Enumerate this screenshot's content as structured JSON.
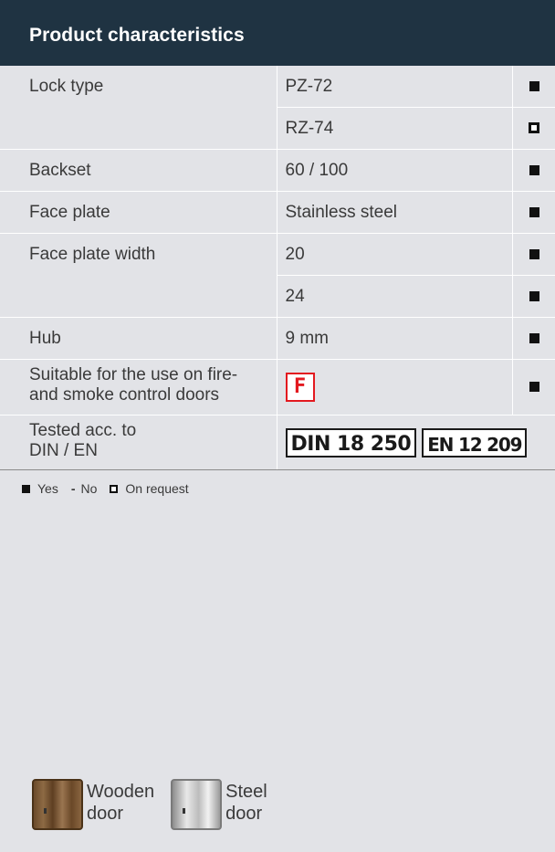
{
  "header": {
    "title": "Product characteristics"
  },
  "rows": [
    {
      "label": "Lock type",
      "value": "PZ-72",
      "marker": "filled"
    },
    {
      "label": "",
      "value": "RZ-74",
      "marker": "open"
    },
    {
      "label": "Backset",
      "value": "60 / 100",
      "marker": "filled"
    },
    {
      "label": "Face plate",
      "value": "Stainless steel",
      "marker": "filled"
    },
    {
      "label": "Face plate width",
      "value": "20",
      "marker": "filled"
    },
    {
      "label": "",
      "value": "24",
      "marker": "filled"
    },
    {
      "label": "Hub",
      "value": "9 mm",
      "marker": "filled"
    },
    {
      "label_line1": "Suitable for the use on fire-",
      "label_line2": "and smoke control doors",
      "badge": "F",
      "marker": "filled"
    },
    {
      "label_line1": "Tested acc. to",
      "label_line2": "DIN / EN",
      "standards": [
        "DIN 18 250",
        "EN 12 209"
      ]
    }
  ],
  "legend": {
    "yes": "Yes",
    "no_symbol": "-",
    "no": "No",
    "on_request": "On request"
  },
  "doors": [
    {
      "line1": "Wooden",
      "line2": "door",
      "icon": "wooden-door-icon"
    },
    {
      "line1": "Steel",
      "line2": "door",
      "icon": "steel-door-icon"
    }
  ],
  "colors": {
    "header_bg": "#1f3342",
    "page_bg": "#e2e3e7",
    "fire_red": "#e3191f"
  }
}
